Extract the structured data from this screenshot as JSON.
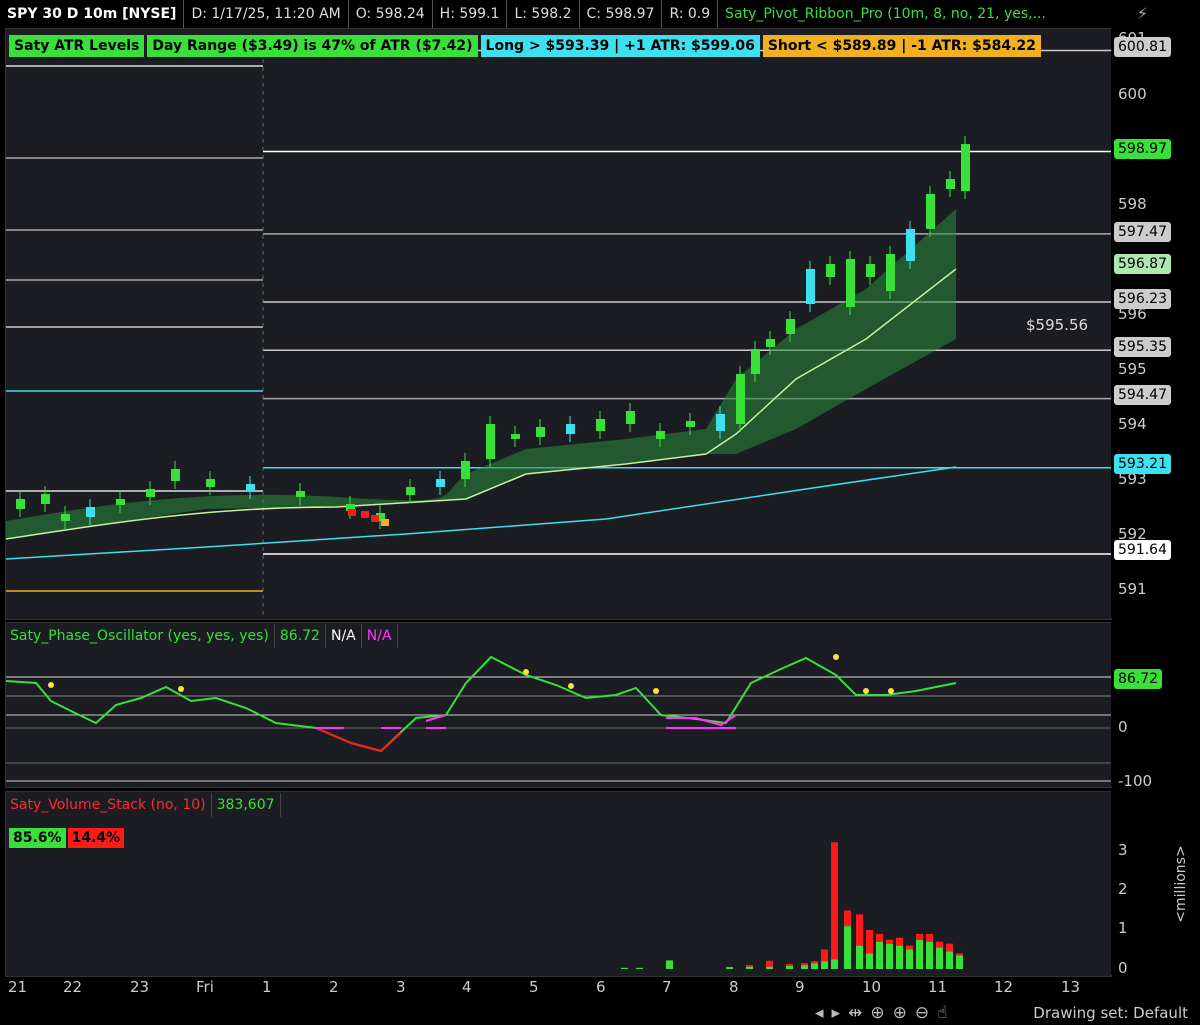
{
  "header": {
    "symbol": "SPY 30 D 10m [NYSE]",
    "date": "D: 1/17/25, 11:20 AM",
    "open": "O: 598.24",
    "high": "H: 599.1",
    "low": "L: 598.2",
    "close": "C: 598.97",
    "range": "R: 0.9",
    "study": "Saty_Pivot_Ribbon_Pro (10m, 8, no, 21, yes,..."
  },
  "atr_labels": {
    "title": "Saty ATR Levels",
    "day_range": "Day Range ($3.49) is 47% of ATR ($7.42)",
    "long": "Long > $593.39 | +1 ATR: $599.06",
    "short": "Short < $589.89 | -1 ATR: $584.22"
  },
  "price_axis": {
    "ticks": [
      "601",
      "600",
      "598",
      "596",
      "595",
      "594",
      "593",
      "592",
      "591"
    ],
    "tags": [
      "600.81",
      "598.97",
      "597.47",
      "596.87",
      "596.23",
      "595.35",
      "594.47",
      "593.21",
      "591.64"
    ],
    "annotation": "$595.56"
  },
  "oscillator": {
    "title": "Saty_Phase_Oscillator (yes, yes, yes)",
    "value": "86.72",
    "na1": "N/A",
    "na2": "N/A",
    "axis": [
      "0",
      "-100"
    ],
    "tag": "86.72"
  },
  "volume": {
    "title": "Saty_Volume_Stack (no, 10)",
    "value": "383,607",
    "buy_pct": "85.6%",
    "sell_pct": "14.4%",
    "axis": [
      "3",
      "2",
      "1",
      "0"
    ],
    "unit": "<millions>"
  },
  "x_axis": [
    "21",
    "22",
    "23",
    "Fri",
    "1",
    "2",
    "3",
    "4",
    "5",
    "6",
    "7",
    "8",
    "9",
    "10",
    "11",
    "12",
    "13"
  ],
  "footer": {
    "drawing_set": "Drawing set: Default"
  },
  "colors": {
    "green": "#39e039",
    "cyan": "#3ee0f0",
    "orange": "#f0b020",
    "red": "#ff1a1a",
    "magenta": "#ff33ff"
  }
}
